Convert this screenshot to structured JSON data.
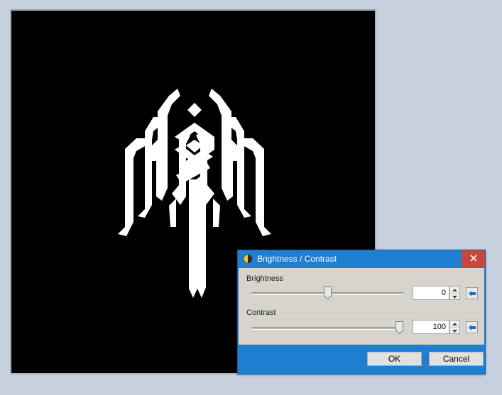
{
  "dialog": {
    "title": "Brightness / Contrast",
    "close_icon": "close-icon",
    "title_icon": "brightness-contrast-icon",
    "brightness": {
      "label": "Brightness",
      "value": "0",
      "slider_level_fraction": 0.5
    },
    "contrast": {
      "label": "Contrast",
      "value": "100",
      "slider_level_fraction": 1.0
    },
    "ok_label": "OK",
    "cancel_label": "Cancel"
  },
  "colors": {
    "desktop_bg": "#c7d0de",
    "canvas_bg": "#000000",
    "logo": "#ffffff",
    "titlebar": "#1e7ed0",
    "close_button": "#c9463d",
    "dialog_body": "#d7d4cd"
  }
}
